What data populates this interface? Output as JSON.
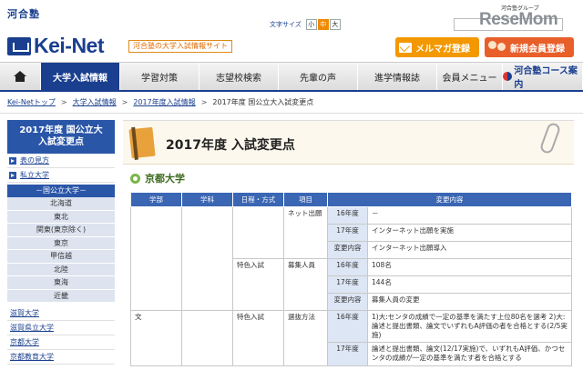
{
  "header": {
    "logo_small": "河合塾",
    "logo_main": "Kei-Net",
    "tagline": "河合塾の大学入試情報サイト",
    "fontsize_label": "文字サイズ",
    "fontsize_options": [
      "小",
      "中",
      "大"
    ],
    "group_text": "河合塾グループ",
    "resemom": "ReseMom",
    "mailmag_label": "メルマガ登録",
    "register_label": "新規会員登録"
  },
  "gnav": {
    "items": [
      "大学入試情報",
      "学習対策",
      "志望校検索",
      "先輩の声",
      "進学情報誌",
      "会員メニュー",
      "河合塾コース案内"
    ]
  },
  "breadcrumb": {
    "items": [
      "Kei-Netトップ",
      "大学入試情報",
      "2017年度入試情報",
      "2017年度 国公立大入試変更点"
    ]
  },
  "sidebar": {
    "title_line1": "2017年度 国公立大",
    "title_line2": "入試変更点",
    "links": [
      "表の見方",
      "私立大学"
    ],
    "section": "－国公立大学－",
    "regions": [
      "北海道",
      "東北",
      "関東(東京除く)",
      "東京",
      "甲信越",
      "北陸",
      "東海",
      "近畿"
    ],
    "universities": [
      "滋賀大学",
      "滋賀県立大学",
      "京都大学",
      "京都教育大学"
    ]
  },
  "main": {
    "page_title": "2017年度 入試変更点",
    "university": "京都大学",
    "table": {
      "headers": [
        "学部",
        "学科",
        "日程・方式",
        "項目",
        "変更内容"
      ],
      "group1": {
        "method": "",
        "item": "ネット出願",
        "rows": [
          {
            "label": "16年度",
            "content": "－"
          },
          {
            "label": "17年度",
            "content": "インターネット出願を実施"
          },
          {
            "label": "変更内容",
            "content": "インターネット出願導入"
          }
        ]
      },
      "group2": {
        "method": "特色入試",
        "item": "募集人員",
        "rows": [
          {
            "label": "16年度",
            "content": "108名"
          },
          {
            "label": "17年度",
            "content": "144名"
          },
          {
            "label": "変更内容",
            "content": "募集人員の変更"
          }
        ]
      },
      "group3": {
        "faculty": "文",
        "method": "特色入試",
        "item": "選抜方法",
        "rows": [
          {
            "label": "16年度",
            "content": "1)大:センタの成績で一定の基準を満たす上位80名を選考 2)大:論述と提出書類、論文でいずれもA評価の者を合格とする(2/5実施)"
          },
          {
            "label": "17年度",
            "content": "論述と提出書類、論文(12/17実施)で、いずれもA評価、かつセンタの成績が一定の基準を満たす者を合格とする"
          }
        ]
      }
    }
  },
  "colors": {
    "brand_blue": "#1a3f8f",
    "table_header": "#3a66b3",
    "mailmag_orange": "#f39800",
    "register_orange": "#e85f2a"
  }
}
